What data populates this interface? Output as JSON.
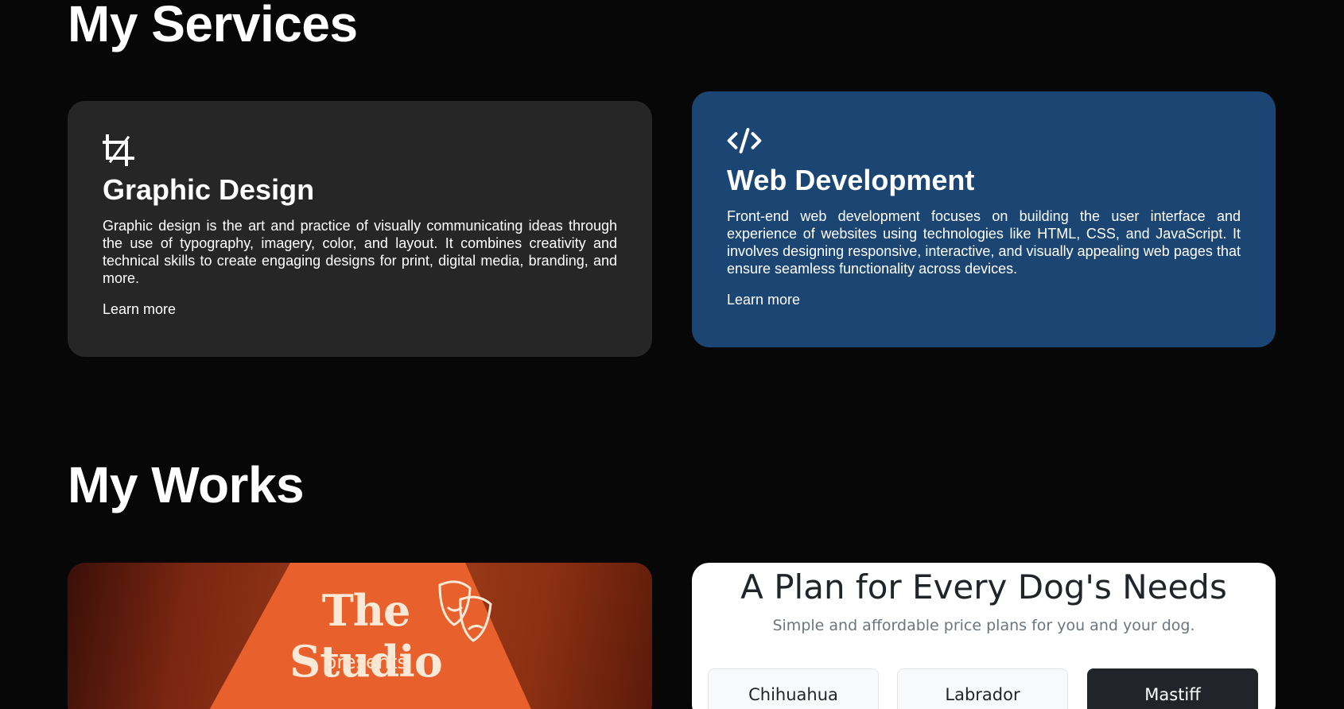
{
  "services": {
    "title": "My Services",
    "cards": [
      {
        "icon": "crop-icon",
        "title": "Graphic Design",
        "description": "Graphic design is the art and practice of visually communicating ideas through the use of typography, imagery, color, and layout. It combines creativity and technical skills to create engaging designs for print, digital media, branding, and more.",
        "link": "Learn more",
        "color": "#262626"
      },
      {
        "icon": "code-icon",
        "title": "Web Development",
        "description": "Front-end web development focuses on building the user interface and experience of websites using technologies like HTML, CSS, and JavaScript. It involves designing responsive, interactive, and visually appealing web pages that ensure seamless functionality across devices.",
        "link": "Learn more",
        "color": "#1b4573"
      }
    ]
  },
  "works": {
    "title": "My Works",
    "studio": {
      "logo": "The Studio",
      "presents": "presents"
    },
    "dog_plans": {
      "title": "A Plan for Every Dog's Needs",
      "subtitle": "Simple and affordable price plans for you and your dog.",
      "plans": [
        "Chihuahua",
        "Labrador",
        "Mastiff"
      ],
      "selected": "Mastiff"
    }
  },
  "colors": {
    "background": "#070707",
    "accent_blue": "#1b4573",
    "card_dark": "#262626"
  }
}
